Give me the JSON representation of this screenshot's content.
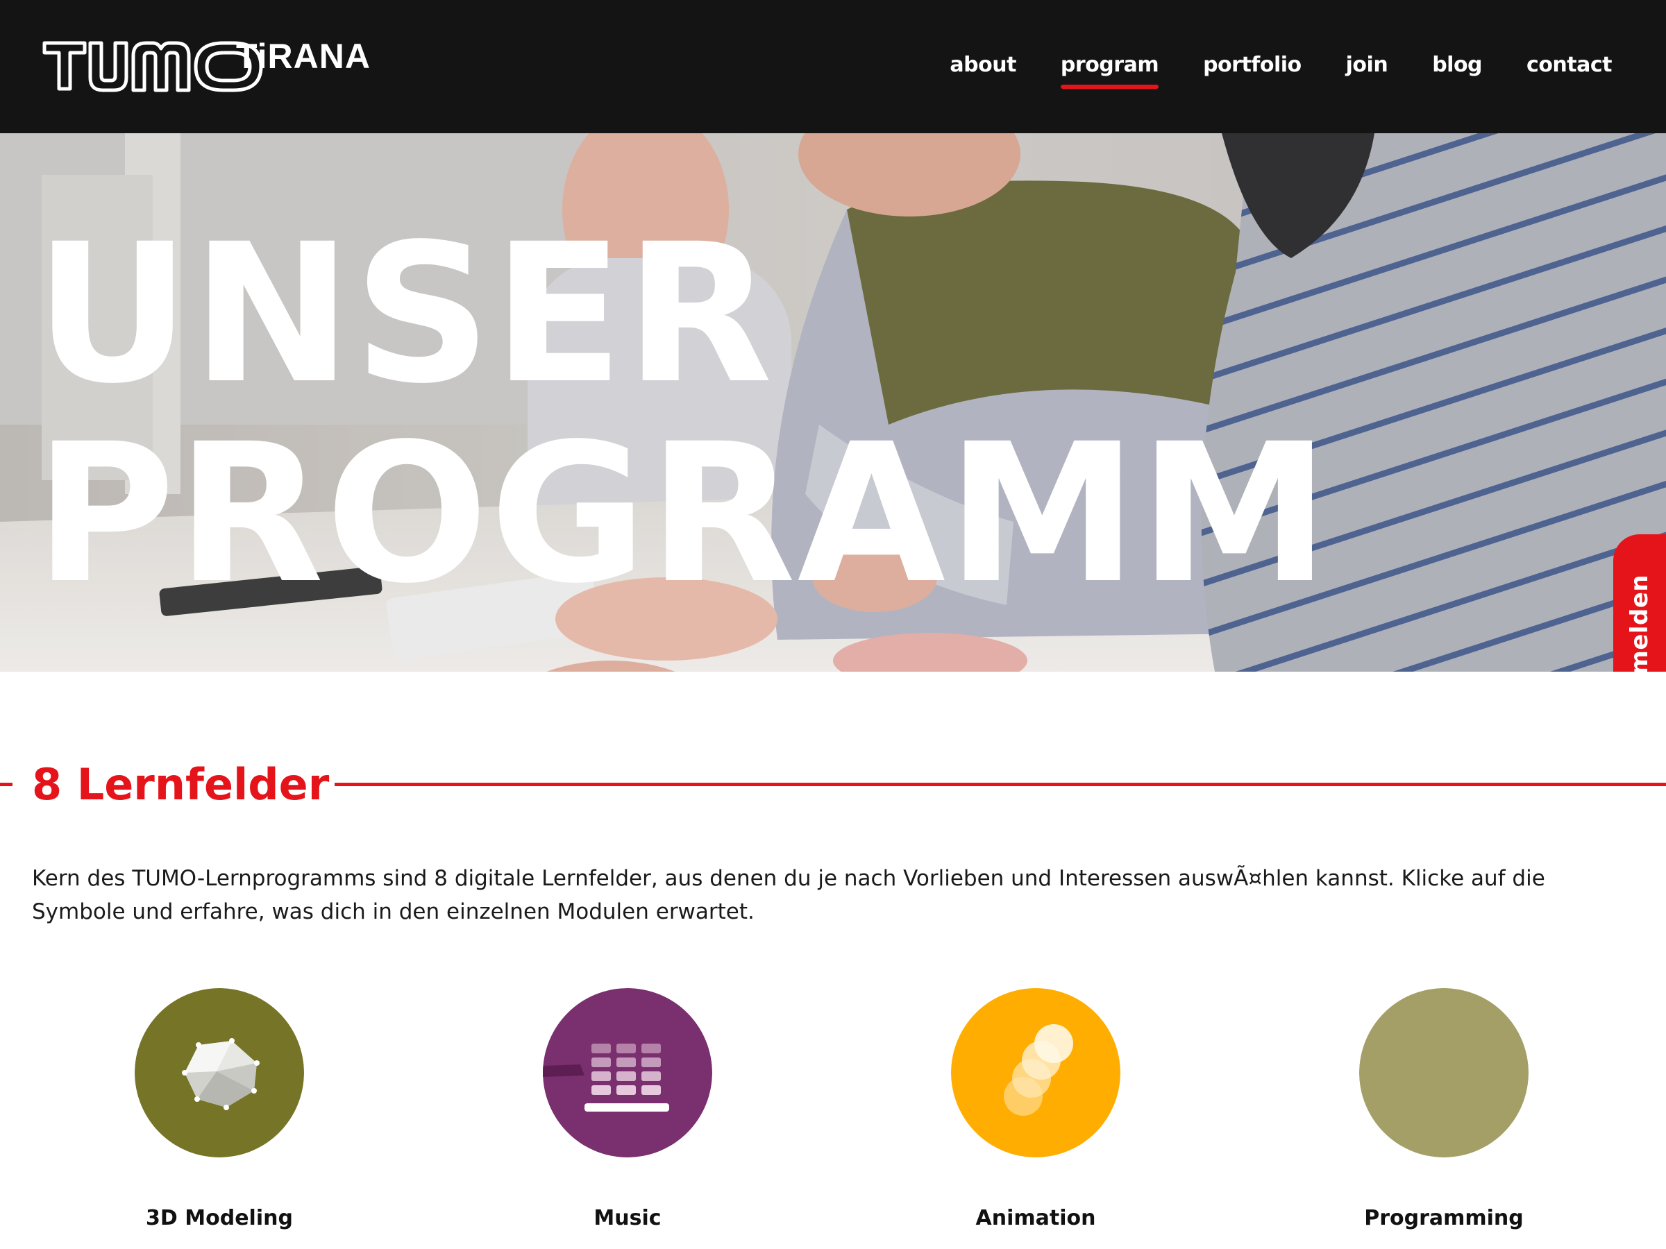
{
  "header": {
    "logo_sub": "TiRANA",
    "nav": [
      {
        "label": "about",
        "active": false
      },
      {
        "label": "program",
        "active": true
      },
      {
        "label": "portfolio",
        "active": false
      },
      {
        "label": "join",
        "active": false
      },
      {
        "label": "blog",
        "active": false
      },
      {
        "label": "contact",
        "active": false
      }
    ]
  },
  "hero": {
    "title_line1": "UNSER",
    "title_line2": "PROGRAMM",
    "signup_tab": "Anmelden"
  },
  "section": {
    "title": "8 Lernfelder",
    "intro": "Kern des TUMO-Lernprogramms sind 8 digitale Lernfelder, aus denen du je nach Vorlieben und Interessen auswÃ¤hlen kannst. Klicke auf die Symbole und erfahre, was dich in den einzelnen Modulen erwartet."
  },
  "fields": [
    {
      "label": "3D Modeling",
      "icon": "3d-modeling-icon",
      "color": "#757427"
    },
    {
      "label": "Music",
      "icon": "music-icon",
      "color": "#7a2f6e"
    },
    {
      "label": "Animation",
      "icon": "animation-icon",
      "color": "#ffad00"
    },
    {
      "label": "Programming",
      "icon": "programming-icon",
      "color": "#a39f66"
    }
  ],
  "colors": {
    "header_bg": "#141414",
    "accent": "#e5141a",
    "text": "#1a1a1a"
  }
}
